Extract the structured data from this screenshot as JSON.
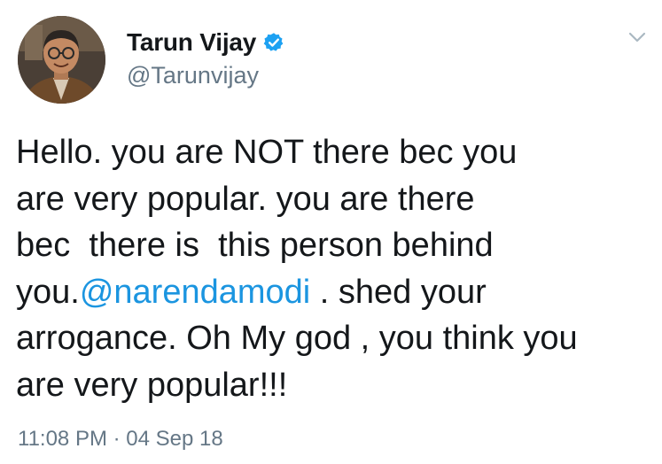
{
  "user": {
    "display_name": "Tarun Vijay",
    "handle": "@Tarunvijay",
    "verified": true
  },
  "tweet": {
    "lines": [
      {
        "before": "Hello. you are NOT there bec you",
        "mention": "",
        "after": ""
      },
      {
        "before": "are very popular. you are there",
        "mention": "",
        "after": ""
      },
      {
        "before": "bec  there is  this person behind",
        "mention": "",
        "after": ""
      },
      {
        "before": "you.",
        "mention": "@narendamodi",
        "after": " . shed your"
      },
      {
        "before": "arrogance. Oh My god , you think you",
        "mention": "",
        "after": ""
      },
      {
        "before": "are very popular!!!",
        "mention": "",
        "after": ""
      }
    ],
    "timestamp": "11:08 PM · 04 Sep 18"
  },
  "icons": {
    "verified": "verified-badge-icon",
    "menu": "chevron-down-icon"
  },
  "colors": {
    "text": "#14171a",
    "secondary": "#657786",
    "link": "#1b95e0",
    "verified": "#1da1f2"
  }
}
